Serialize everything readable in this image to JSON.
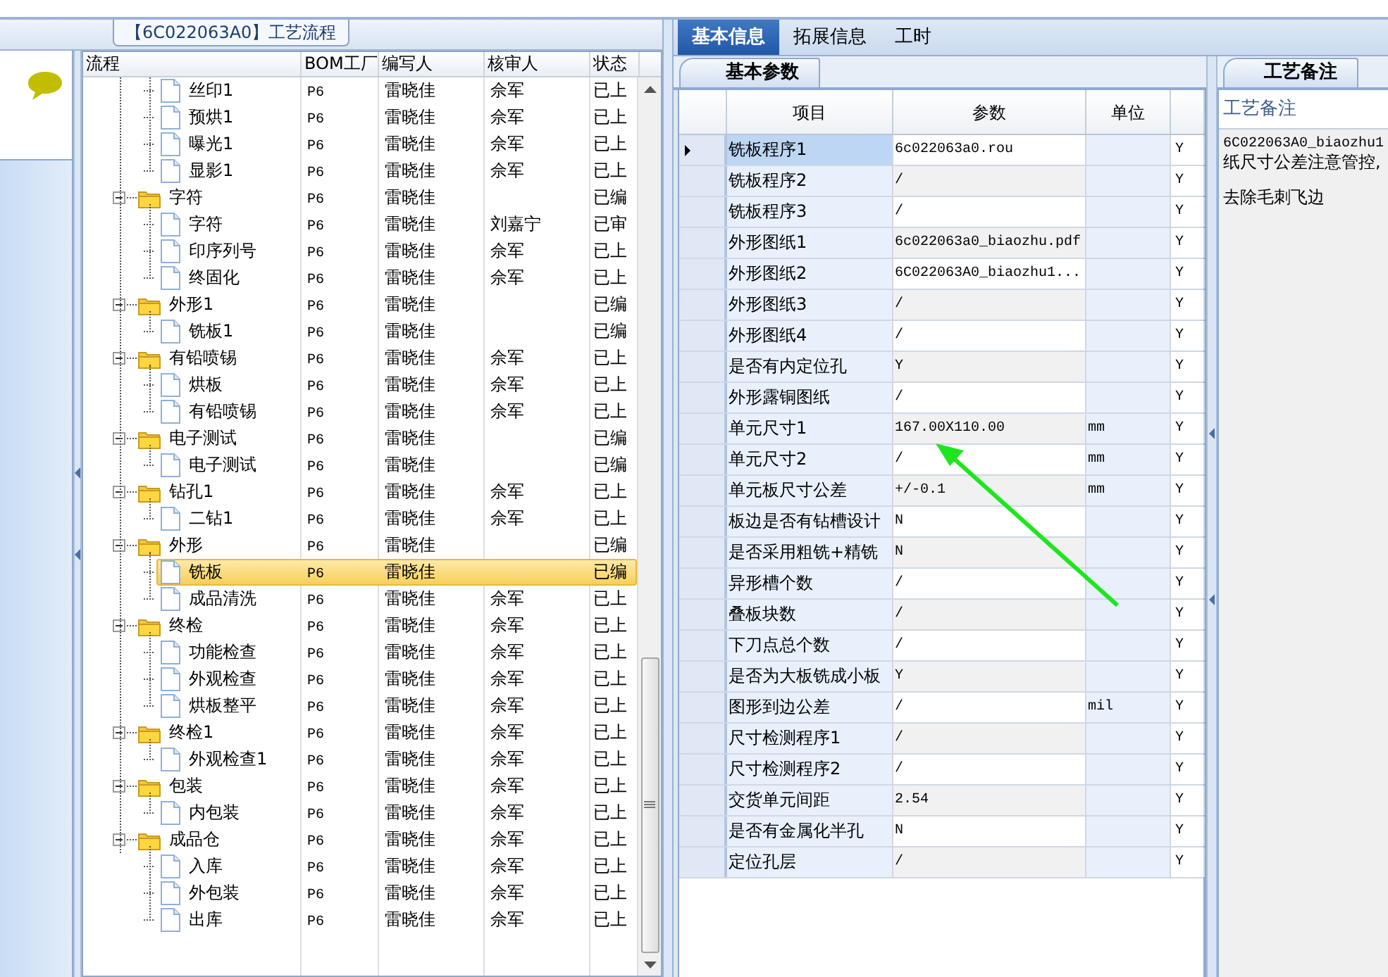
{
  "process_panel": {
    "title": "【6C022063A0】工艺流程",
    "columns": [
      "流程",
      "BOM工厂",
      "编写人",
      "核审人",
      "状态"
    ],
    "tree": [
      {
        "kind": "hidden",
        "children": [
          {
            "kind": "file",
            "label": "丝印1",
            "bom": "P6",
            "writer": "雷晓佳",
            "reviewer": "佘军",
            "status": "已上",
            "selected": false
          },
          {
            "kind": "file",
            "label": "预烘1",
            "bom": "P6",
            "writer": "雷晓佳",
            "reviewer": "佘军",
            "status": "已上",
            "selected": false
          },
          {
            "kind": "file",
            "label": "曝光1",
            "bom": "P6",
            "writer": "雷晓佳",
            "reviewer": "佘军",
            "status": "已上",
            "selected": false
          },
          {
            "kind": "file",
            "label": "显影1",
            "bom": "P6",
            "writer": "雷晓佳",
            "reviewer": "佘军",
            "status": "已上",
            "selected": false
          }
        ]
      },
      {
        "kind": "folder",
        "label": "字符",
        "bom": "P6",
        "writer": "雷晓佳",
        "status": "已编",
        "expanded": true,
        "selected": false,
        "children": [
          {
            "kind": "file",
            "label": "字符",
            "bom": "P6",
            "writer": "雷晓佳",
            "reviewer": "刘嘉宁",
            "status": "已审",
            "selected": false
          },
          {
            "kind": "file",
            "label": "印序列号",
            "bom": "P6",
            "writer": "雷晓佳",
            "reviewer": "佘军",
            "status": "已上",
            "selected": false
          },
          {
            "kind": "file",
            "label": "终固化",
            "bom": "P6",
            "writer": "雷晓佳",
            "reviewer": "佘军",
            "status": "已上",
            "selected": false
          }
        ]
      },
      {
        "kind": "folder",
        "label": "外形1",
        "bom": "P6",
        "writer": "雷晓佳",
        "status": "已编",
        "expanded": true,
        "selected": false,
        "children": [
          {
            "kind": "file",
            "label": "铣板1",
            "bom": "P6",
            "writer": "雷晓佳",
            "status": "已编",
            "selected": false
          }
        ]
      },
      {
        "kind": "folder",
        "label": "有铅喷锡",
        "bom": "P6",
        "writer": "雷晓佳",
        "reviewer": "佘军",
        "status": "已上",
        "expanded": true,
        "selected": false,
        "children": [
          {
            "kind": "file",
            "label": "烘板",
            "bom": "P6",
            "writer": "雷晓佳",
            "reviewer": "佘军",
            "status": "已上",
            "selected": false
          },
          {
            "kind": "file",
            "label": "有铅喷锡",
            "bom": "P6",
            "writer": "雷晓佳",
            "reviewer": "佘军",
            "status": "已上",
            "selected": false
          }
        ]
      },
      {
        "kind": "folder",
        "label": "电子测试",
        "bom": "P6",
        "writer": "雷晓佳",
        "status": "已编",
        "expanded": true,
        "selected": false,
        "children": [
          {
            "kind": "file",
            "label": "电子测试",
            "bom": "P6",
            "writer": "雷晓佳",
            "status": "已编",
            "selected": false
          }
        ]
      },
      {
        "kind": "folder",
        "label": "钻孔1",
        "bom": "P6",
        "writer": "雷晓佳",
        "reviewer": "佘军",
        "status": "已上",
        "expanded": true,
        "selected": false,
        "children": [
          {
            "kind": "file",
            "label": "二钻1",
            "bom": "P6",
            "writer": "雷晓佳",
            "reviewer": "佘军",
            "status": "已上",
            "selected": false
          }
        ]
      },
      {
        "kind": "folder",
        "label": "外形",
        "bom": "P6",
        "writer": "雷晓佳",
        "status": "已编",
        "expanded": true,
        "selected": false,
        "children": [
          {
            "kind": "file",
            "label": "铣板",
            "bom": "P6",
            "writer": "雷晓佳",
            "status": "已编",
            "selected": true
          },
          {
            "kind": "file",
            "label": "成品清洗",
            "bom": "P6",
            "writer": "雷晓佳",
            "reviewer": "佘军",
            "status": "已上",
            "selected": false
          }
        ]
      },
      {
        "kind": "folder",
        "label": "终检",
        "bom": "P6",
        "writer": "雷晓佳",
        "reviewer": "佘军",
        "status": "已上",
        "expanded": true,
        "selected": false,
        "children": [
          {
            "kind": "file",
            "label": "功能检查",
            "bom": "P6",
            "writer": "雷晓佳",
            "reviewer": "佘军",
            "status": "已上",
            "selected": false
          },
          {
            "kind": "file",
            "label": "外观检查",
            "bom": "P6",
            "writer": "雷晓佳",
            "reviewer": "佘军",
            "status": "已上",
            "selected": false
          },
          {
            "kind": "file",
            "label": "烘板整平",
            "bom": "P6",
            "writer": "雷晓佳",
            "reviewer": "佘军",
            "status": "已上",
            "selected": false
          }
        ]
      },
      {
        "kind": "folder",
        "label": "终检1",
        "bom": "P6",
        "writer": "雷晓佳",
        "reviewer": "佘军",
        "status": "已上",
        "expanded": true,
        "selected": false,
        "children": [
          {
            "kind": "file",
            "label": "外观检查1",
            "bom": "P6",
            "writer": "雷晓佳",
            "reviewer": "佘军",
            "status": "已上",
            "selected": false
          }
        ]
      },
      {
        "kind": "folder",
        "label": "包装",
        "bom": "P6",
        "writer": "雷晓佳",
        "reviewer": "佘军",
        "status": "已上",
        "expanded": true,
        "selected": false,
        "children": [
          {
            "kind": "file",
            "label": "内包装",
            "bom": "P6",
            "writer": "雷晓佳",
            "reviewer": "佘军",
            "status": "已上",
            "selected": false
          }
        ]
      },
      {
        "kind": "folder",
        "label": "成品仓",
        "bom": "P6",
        "writer": "雷晓佳",
        "reviewer": "佘军",
        "status": "已上",
        "expanded": true,
        "selected": false,
        "children": [
          {
            "kind": "file",
            "label": "入库",
            "bom": "P6",
            "writer": "雷晓佳",
            "reviewer": "佘军",
            "status": "已上",
            "selected": false
          },
          {
            "kind": "file",
            "label": "外包装",
            "bom": "P6",
            "writer": "雷晓佳",
            "reviewer": "佘军",
            "status": "已上",
            "selected": false
          },
          {
            "kind": "file",
            "label": "出库",
            "bom": "P6",
            "writer": "雷晓佳",
            "reviewer": "佘军",
            "status": "已上",
            "selected": false
          }
        ]
      }
    ]
  },
  "tabs": [
    {
      "label": "基本信息",
      "selected": true
    },
    {
      "label": "拓展信息",
      "selected": false
    },
    {
      "label": "工时",
      "selected": false
    }
  ],
  "params": {
    "subtab": "基本参数",
    "columns": [
      "项目",
      "参数",
      "单位"
    ],
    "rows": [
      {
        "item": "铣板程序1",
        "value": "6c022063a0.rou",
        "column_4": "Y",
        "selected": true
      },
      {
        "item": "铣板程序2",
        "value": "/",
        "column_4": "Y",
        "selected": false
      },
      {
        "item": "铣板程序3",
        "value": "/",
        "column_4": "Y",
        "selected": false
      },
      {
        "item": "外形图纸1",
        "value": "6c022063a0_biaozhu.pdf",
        "column_4": "Y",
        "selected": false
      },
      {
        "item": "外形图纸2",
        "value": "6C022063A0_biaozhu1...",
        "column_4": "Y",
        "selected": false
      },
      {
        "item": "外形图纸3",
        "value": "/",
        "column_4": "Y",
        "selected": false
      },
      {
        "item": "外形图纸4",
        "value": "/",
        "column_4": "Y",
        "selected": false
      },
      {
        "item": "是否有内定位孔",
        "value": "Y",
        "column_4": "Y",
        "selected": false
      },
      {
        "item": "外形露铜图纸",
        "value": "/",
        "column_4": "Y",
        "selected": false
      },
      {
        "item": "单元尺寸1",
        "value": "167.00X110.00",
        "unit": "mm",
        "column_4": "Y",
        "selected": false
      },
      {
        "item": "单元尺寸2",
        "value": "/",
        "unit": "mm",
        "column_4": "Y",
        "selected": false
      },
      {
        "item": "单元板尺寸公差",
        "value": "+/-0.1",
        "unit": "mm",
        "column_4": "Y",
        "selected": false
      },
      {
        "item": "板边是否有钻槽设计",
        "value": "N",
        "column_4": "Y",
        "selected": false
      },
      {
        "item": "是否采用粗铣+精铣",
        "value": "N",
        "column_4": "Y",
        "selected": false
      },
      {
        "item": "异形槽个数",
        "value": "/",
        "column_4": "Y",
        "selected": false
      },
      {
        "item": "叠板块数",
        "value": "/",
        "column_4": "Y",
        "selected": false
      },
      {
        "item": "下刀点总个数",
        "value": "/",
        "column_4": "Y",
        "selected": false
      },
      {
        "item": "是否为大板铣成小板",
        "value": "Y",
        "column_4": "Y",
        "selected": false
      },
      {
        "item": "图形到边公差",
        "value": "/",
        "unit": "mil",
        "column_4": "Y",
        "selected": false
      },
      {
        "item": "尺寸检测程序1",
        "value": "/",
        "column_4": "Y",
        "selected": false
      },
      {
        "item": "尺寸检测程序2",
        "value": "/",
        "column_4": "Y",
        "selected": false
      },
      {
        "item": "交货单元间距",
        "value": "2.54",
        "column_4": "Y",
        "selected": false
      },
      {
        "item": "是否有金属化半孔",
        "value": "N",
        "column_4": "Y",
        "selected": false
      },
      {
        "item": "定位孔层",
        "value": "/",
        "column_4": "Y",
        "selected": false
      }
    ]
  },
  "notes": {
    "tab": "工艺备注",
    "heading": "工艺备注",
    "paragraphs": [
      [
        "6C022063A0_biaozhu1",
        "纸尺寸公差注意管控,"
      ],
      [
        "去除毛刺飞边"
      ]
    ]
  }
}
